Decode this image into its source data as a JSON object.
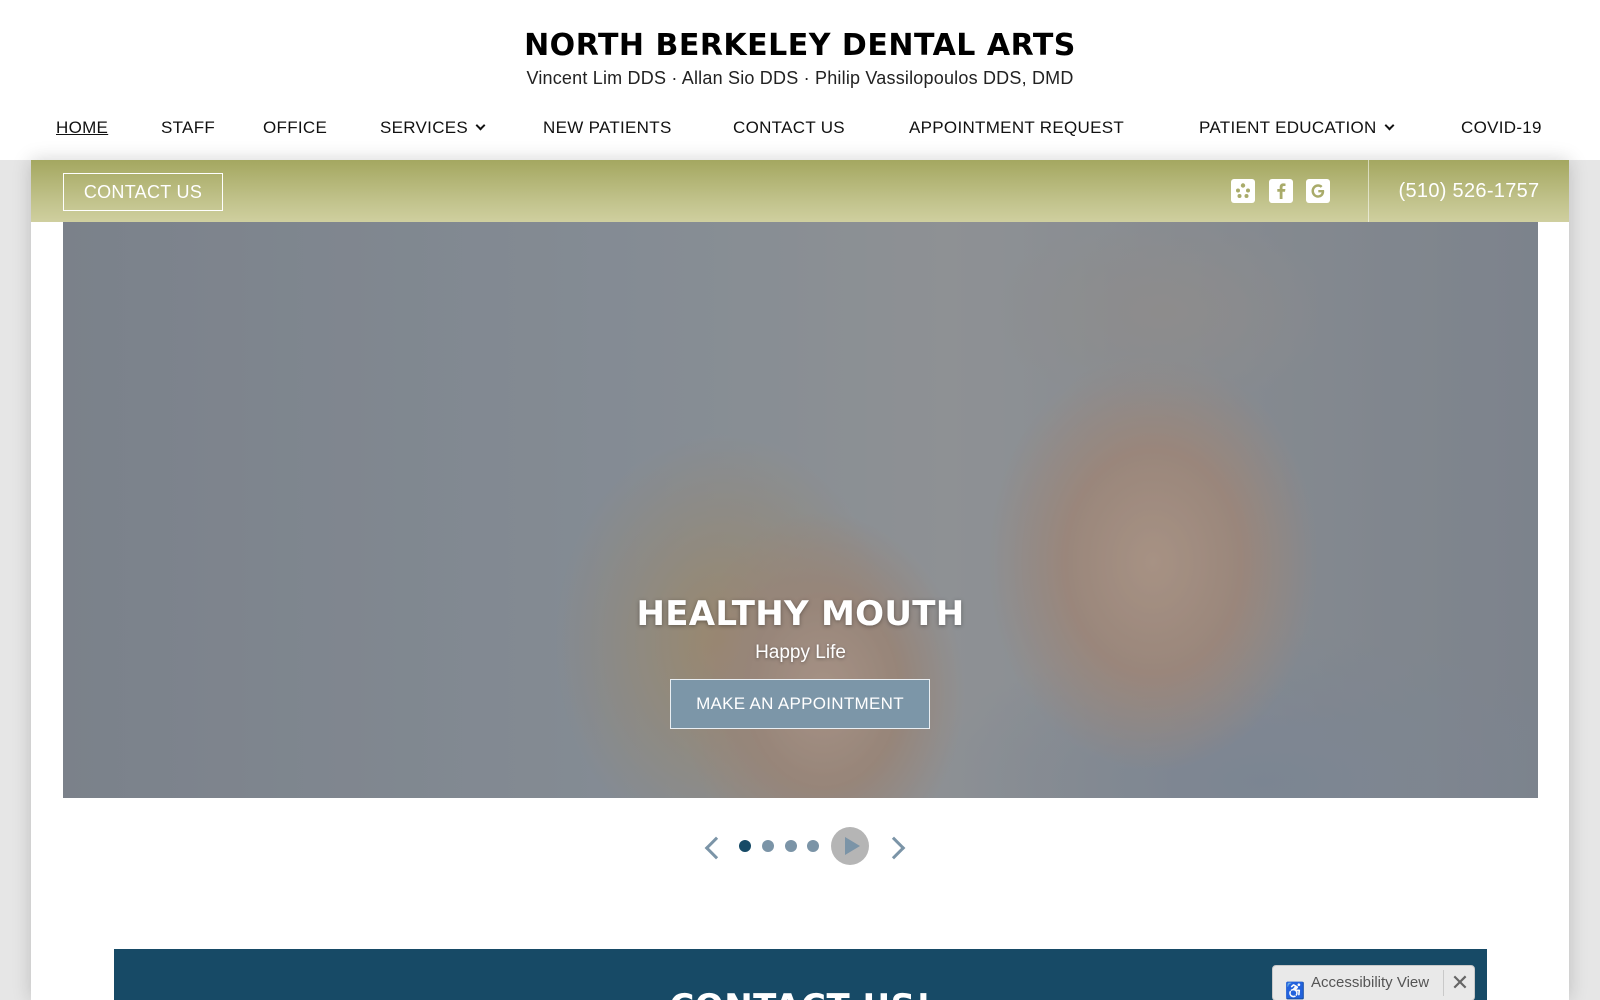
{
  "header": {
    "title": "NORTH BERKELEY DENTAL ARTS",
    "subtitle": "Vincent Lim DDS · Allan Sio DDS · Philip Vassilopoulos DDS, DMD"
  },
  "nav": {
    "home": "HOME",
    "staff": "STAFF",
    "office": "OFFICE",
    "services": "SERVICES",
    "new_patients": "NEW PATIENTS",
    "contact_us": "CONTACT US",
    "appointment_request": "APPOINTMENT REQUEST",
    "patient_education": "PATIENT EDUCATION",
    "covid": "COVID-19"
  },
  "topbar": {
    "contact_label": "CONTACT US",
    "phone": "(510) 526-1757",
    "social_icons": [
      "yelp-icon",
      "facebook-icon",
      "google-icon"
    ],
    "gradient_top": "#a4a760",
    "gradient_bottom": "#cfcf9f"
  },
  "hero": {
    "title": "HEALTHY MOUTH",
    "subtitle": "Happy Life",
    "cta_label": "MAKE AN APPOINTMENT",
    "cta_color": "#7c96a8"
  },
  "slider": {
    "slide_count": 4,
    "active_slide": 1
  },
  "contact_section": {
    "heading": "CONTACT US!",
    "background": "#174a66"
  },
  "accessibility": {
    "label": "Accessibility View"
  }
}
